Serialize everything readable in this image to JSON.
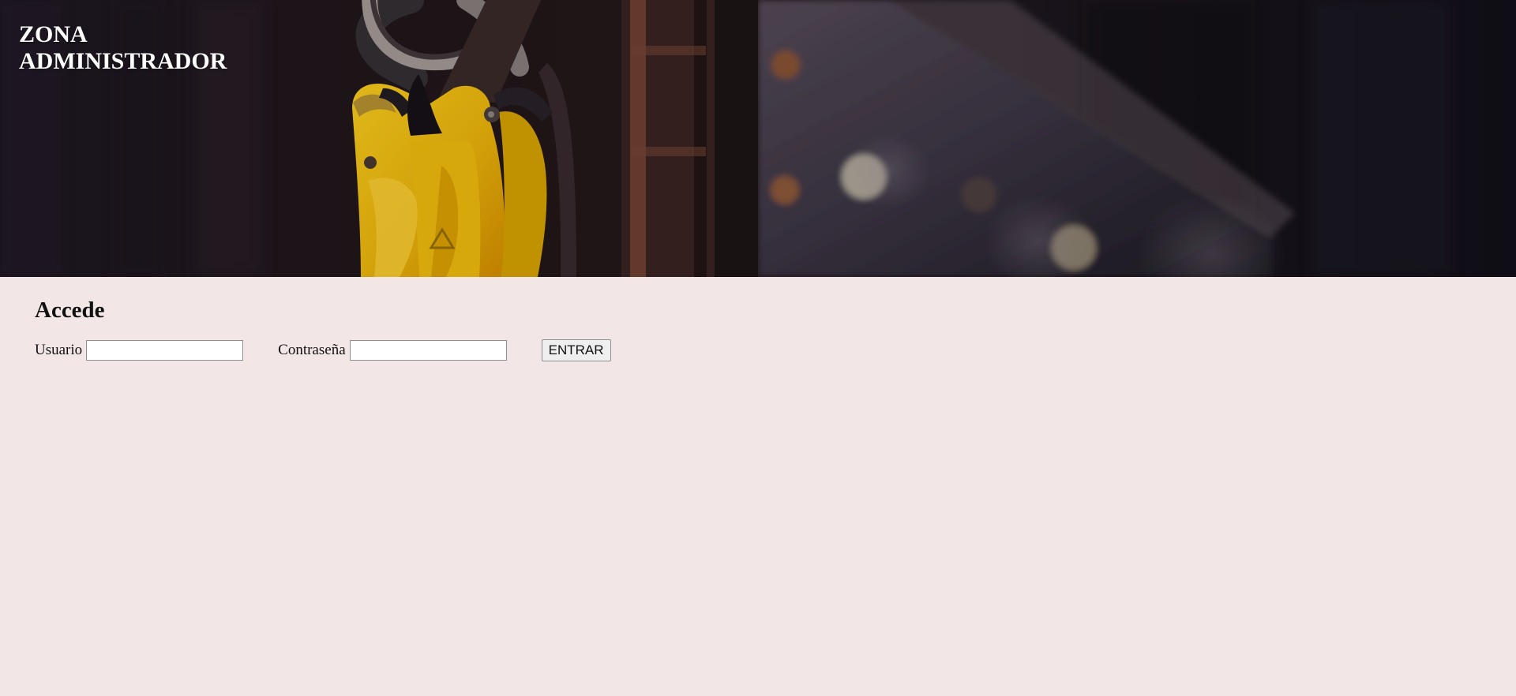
{
  "header": {
    "title_line_1": "ZONA",
    "title_line_2": "ADMINISTRADOR"
  },
  "login": {
    "heading": "Accede",
    "username_label": "Usuario",
    "username_value": "",
    "password_label": "Contraseña",
    "password_value": "",
    "submit_label": "ENTRAR"
  },
  "colors": {
    "page_background": "#f2e6e6",
    "hero_dark": "#19141f",
    "lock_yellow": "#f3bf12",
    "title_text": "#ffffff"
  },
  "icons": {
    "hero_image": "padlock-image"
  }
}
